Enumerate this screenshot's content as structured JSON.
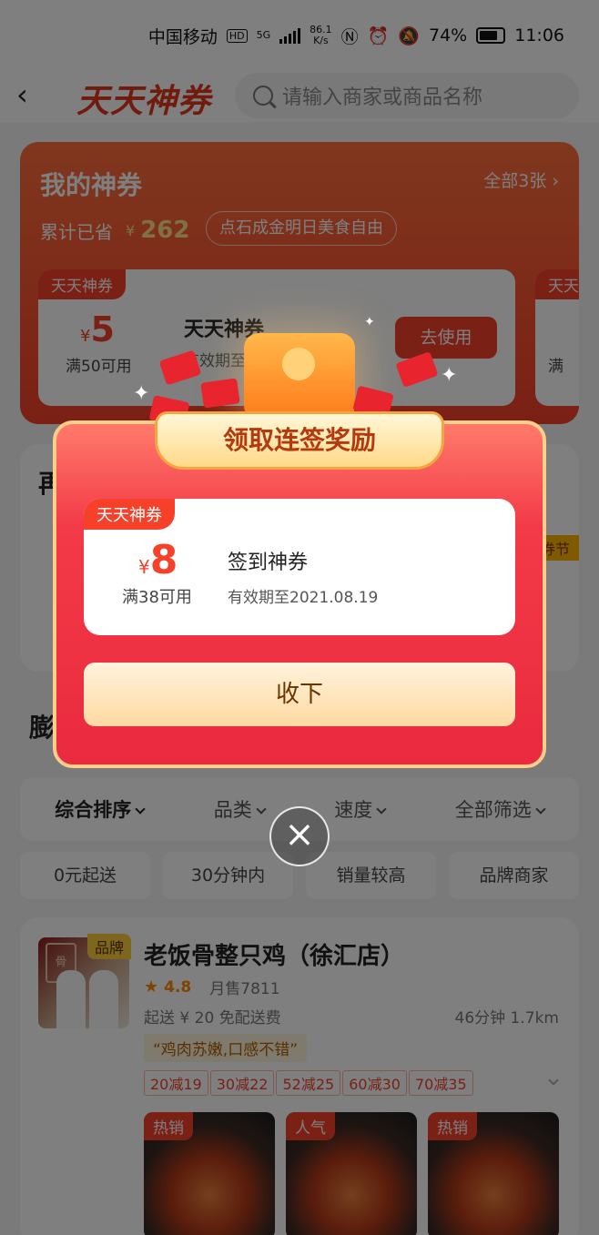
{
  "status_bar": {
    "carrier": "中国移动",
    "hd": "HD",
    "net_gen": "5G",
    "speed": "86.1",
    "speed_unit": "K/s",
    "battery": "74%",
    "time": "11:06"
  },
  "header": {
    "brand": "天天神券",
    "search_placeholder": "请输入商家或商品名称"
  },
  "my_coupons": {
    "title": "我的神券",
    "all_link": "全部3张",
    "saved_label": "累计已省",
    "saved_currency": "¥",
    "saved_amount": "262",
    "promo_pill": "点石成金明日美食自由",
    "card": {
      "tag": "天天神券",
      "currency": "¥",
      "value": "5",
      "condition": "满50可用",
      "name": "天天神券",
      "validity": "有效期至",
      "button": "去使用"
    },
    "card2_tag": "天天",
    "card2_cond": "满"
  },
  "seckill": {
    "title": "再",
    "tag": "券节"
  },
  "section_title": "膨",
  "sort_bar": {
    "items": [
      "综合排序",
      "品类",
      "速度",
      "全部筛选"
    ]
  },
  "filters": [
    "0元起送",
    "30分钟内",
    "销量较高",
    "品牌商家"
  ],
  "shop": {
    "badge": "品牌",
    "logo_text": "骨",
    "name": "老饭骨整只鸡（徐汇店）",
    "rating": "4.8",
    "monthly_sales": "月售7811",
    "delivery": "起送 ¥ 20 免配送费",
    "time_distance": "46分钟  1.7km",
    "review": "“鸡肉苏嫩,口感不错”",
    "promos": [
      "20减19",
      "30减22",
      "52减25",
      "60减30",
      "70减35"
    ],
    "dish_tags": [
      "热销",
      "人气",
      "热销"
    ]
  },
  "modal": {
    "title": "领取连签奖励",
    "coupon": {
      "tag": "天天神券",
      "currency": "¥",
      "value": "8",
      "condition": "满38可用",
      "name": "签到神券",
      "validity": "有效期至2021.08.19"
    },
    "accept_button": "收下"
  },
  "colors": {
    "accent": "#f6402a",
    "modal_border": "#ffcf8a"
  }
}
